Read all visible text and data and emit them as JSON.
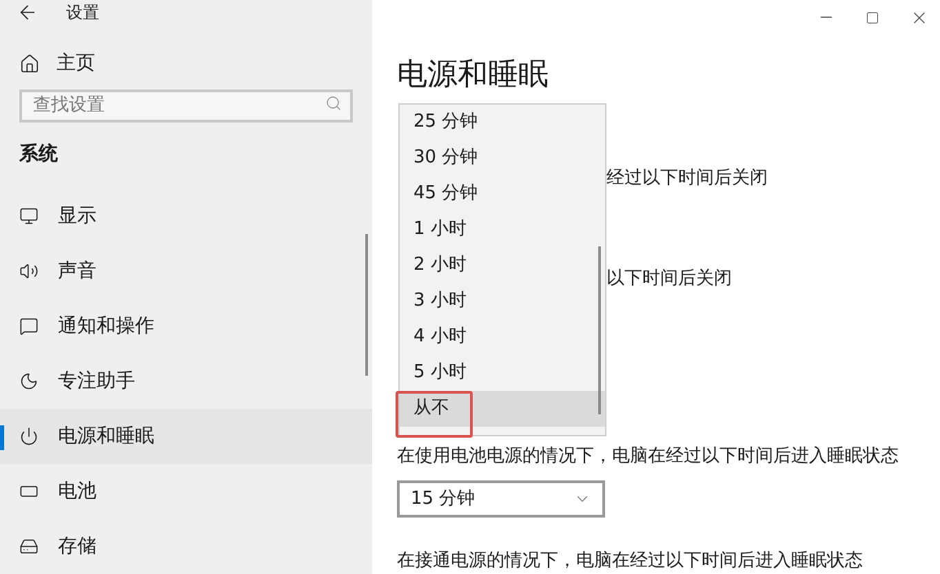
{
  "window": {
    "title": "设置"
  },
  "sidebar": {
    "home": "主页",
    "search": {
      "placeholder": "查找设置"
    },
    "section": "系统",
    "items": [
      {
        "kind": "display",
        "label": "显示",
        "selected": false
      },
      {
        "kind": "sound",
        "label": "声音",
        "selected": false
      },
      {
        "kind": "notifications",
        "label": "通知和操作",
        "selected": false
      },
      {
        "kind": "focus",
        "label": "专注助手",
        "selected": false
      },
      {
        "kind": "power",
        "label": "电源和睡眠",
        "selected": true
      },
      {
        "kind": "battery",
        "label": "电池",
        "selected": false
      },
      {
        "kind": "storage",
        "label": "存储",
        "selected": false
      }
    ]
  },
  "main": {
    "title": "电源和睡眠",
    "screen_battery_label": "经过以下时间后关闭",
    "screen_plugged_label": "以下时间后关闭",
    "sleep_battery_label": "在使用电池电源的情况下，电脑在经过以下时间后进入睡眠状态",
    "sleep_battery_select": {
      "value": "15 分钟"
    },
    "sleep_plugged_label": "在接通电源的情况下，电脑在经过以下时间后进入睡眠状态",
    "dropdown": {
      "options": [
        {
          "label": "25 分钟",
          "selected": false
        },
        {
          "label": "30 分钟",
          "selected": false
        },
        {
          "label": "45 分钟",
          "selected": false
        },
        {
          "label": "1 小时",
          "selected": false
        },
        {
          "label": "2 小时",
          "selected": false
        },
        {
          "label": "3 小时",
          "selected": false
        },
        {
          "label": "4 小时",
          "selected": false
        },
        {
          "label": "5 小时",
          "selected": false
        },
        {
          "label": "从不",
          "selected": true
        }
      ]
    }
  }
}
